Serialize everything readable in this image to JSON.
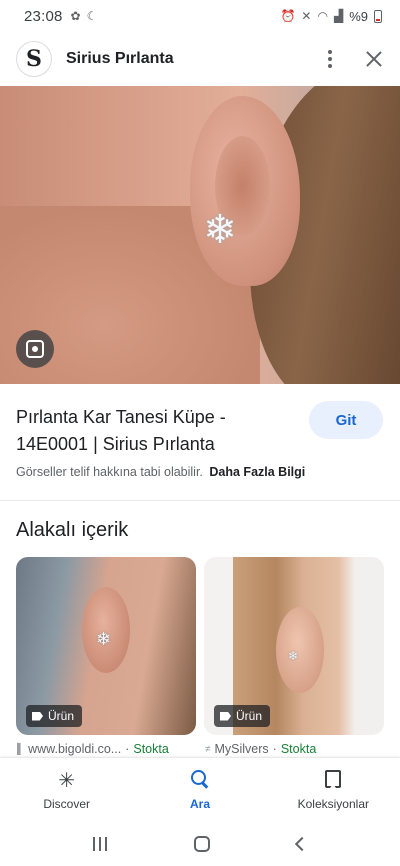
{
  "status_bar": {
    "time": "23:08",
    "battery": "%9"
  },
  "header": {
    "site_name": "Sirius Pırlanta",
    "logo_letter": "S"
  },
  "result": {
    "title": "Pırlanta Kar Tanesi Küpe - 14E0001 | Sirius Pırlanta",
    "go_label": "Git",
    "copyright_notice": "Görseller telif hakkına tabi olabilir.",
    "more_info": "Daha Fazla Bilgi"
  },
  "related": {
    "heading": "Alakalı içerik",
    "items": [
      {
        "chip": "Ürün",
        "source": "www.bigoldi.co...",
        "stock": "Stokta"
      },
      {
        "chip": "Ürün",
        "source": "MySilvers",
        "stock": "Stokta"
      }
    ]
  },
  "bottom_nav": {
    "items": [
      {
        "label": "Discover",
        "icon": "asterisk-icon"
      },
      {
        "label": "Ara",
        "icon": "search-icon",
        "active": true
      },
      {
        "label": "Koleksiyonlar",
        "icon": "collections-icon"
      }
    ]
  },
  "colors": {
    "accent": "#1967d2",
    "accent_bg": "#e8f0fe",
    "in_stock": "#188038"
  }
}
